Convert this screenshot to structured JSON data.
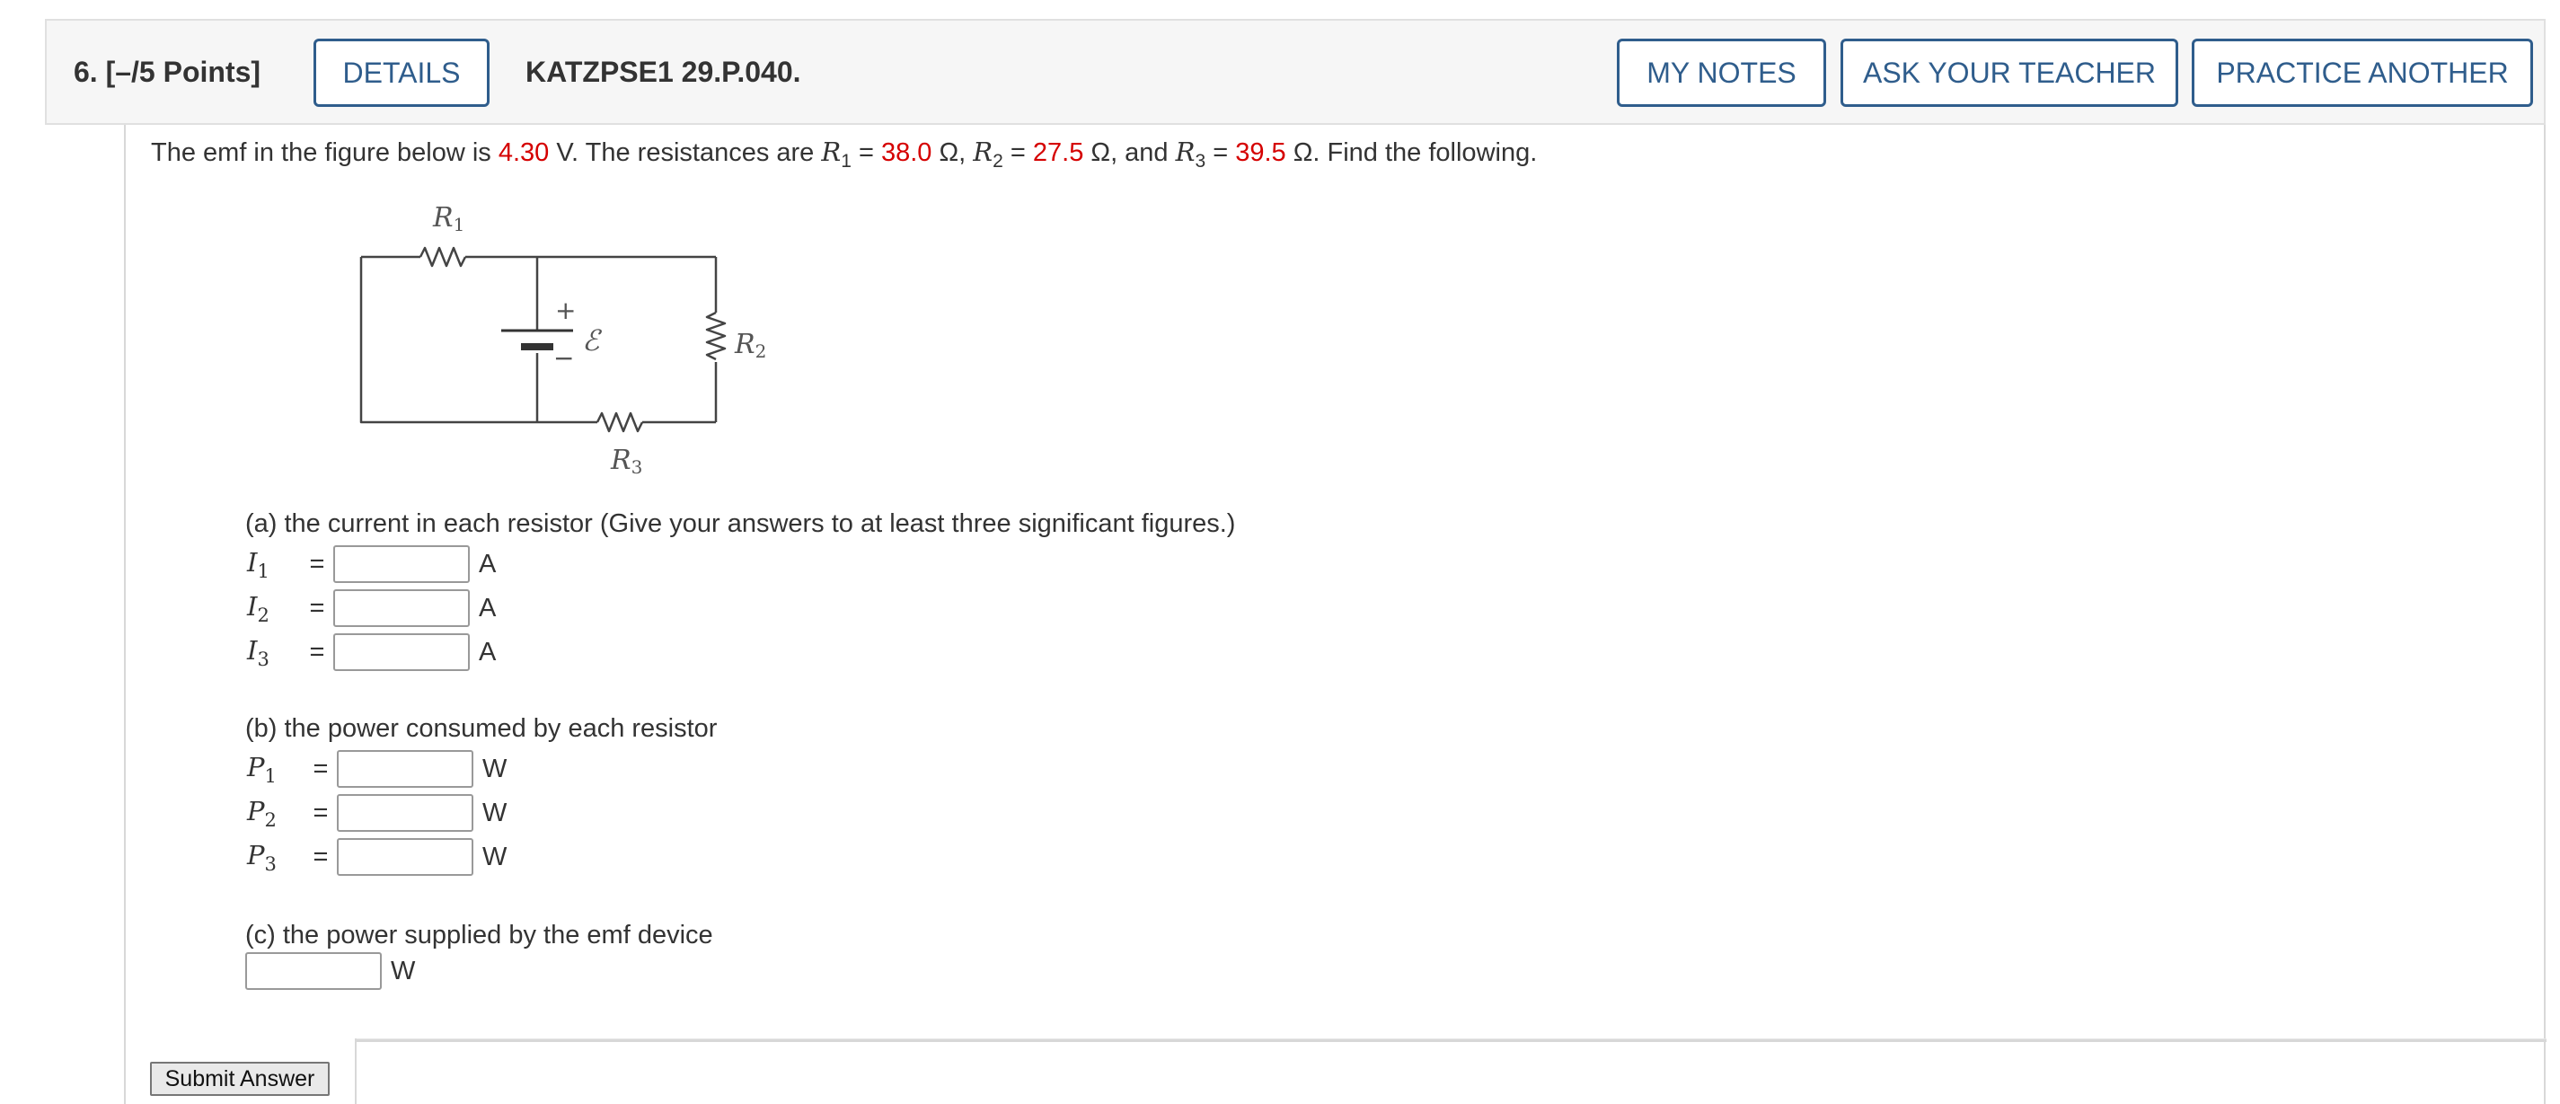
{
  "header": {
    "question_label": "6.  [–/5 Points]",
    "details_button": "DETAILS",
    "question_code": "KATZPSE1 29.P.040.",
    "my_notes_button": "MY NOTES",
    "ask_teacher_button": "ASK YOUR TEACHER",
    "practice_another_button": "PRACTICE ANOTHER",
    "accent_color": "#2f5d8c"
  },
  "problem": {
    "text_1": "The emf in the figure below is ",
    "emf_value": "4.30",
    "text_2": " V. The resistances are  ",
    "r1_label": "R",
    "r1_sub": "1",
    "eq": " = ",
    "r1_value": "38.0",
    "ohm_comma": " Ω,  ",
    "r2_label": "R",
    "r2_sub": "2",
    "r2_value": "27.5",
    "ohm_and": " Ω,  and  ",
    "r3_label": "R",
    "r3_sub": "3",
    "r3_value": "39.5",
    "text_end": " Ω.  Find the following.",
    "value_color": "#d50000"
  },
  "figure": {
    "r1": "R",
    "r1_sub": "1",
    "r2": "R",
    "r2_sub": "2",
    "r3": "R",
    "r3_sub": "3",
    "emf": "ℰ",
    "plus": "+",
    "minus": "−"
  },
  "part_a": {
    "title": "(a) the current in each resistor (Give your answers to at least three significant figures.)",
    "rows": [
      {
        "var": "I",
        "sub": "1",
        "eq": "=",
        "value": "",
        "unit": "A"
      },
      {
        "var": "I",
        "sub": "2",
        "eq": "=",
        "value": "",
        "unit": "A"
      },
      {
        "var": "I",
        "sub": "3",
        "eq": "=",
        "value": "",
        "unit": "A"
      }
    ]
  },
  "part_b": {
    "title": "(b) the power consumed by each resistor",
    "rows": [
      {
        "var": "P",
        "sub": "1",
        "eq": "=",
        "value": "",
        "unit": "W"
      },
      {
        "var": "P",
        "sub": "2",
        "eq": "=",
        "value": "",
        "unit": "W"
      },
      {
        "var": "P",
        "sub": "3",
        "eq": "=",
        "value": "",
        "unit": "W"
      }
    ]
  },
  "part_c": {
    "title": "(c) the power supplied by the emf device",
    "value": "",
    "unit": "W"
  },
  "submit_button": "Submit Answer"
}
